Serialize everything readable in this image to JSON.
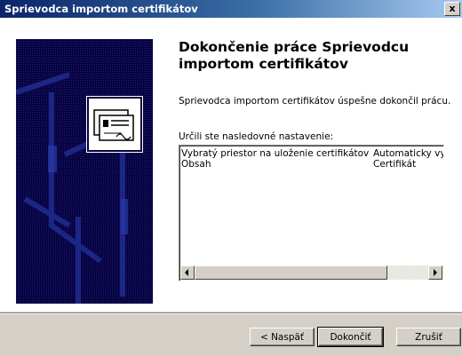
{
  "window": {
    "title": "Sprievodca importom certifikátov",
    "close_glyph": "x"
  },
  "wizard": {
    "heading": "Dokončenie práce Sprievodcu importom certifikátov",
    "success_message": "Sprievodca importom certifikátov úspešne dokončil prácu.",
    "settings_label": "Určili ste nasledovné nastavenie:",
    "settings": [
      {
        "name": "Vybratý priestor na uloženie certifikátov",
        "value": "Automaticky vy"
      },
      {
        "name": "Obsah",
        "value": "Certifikát"
      }
    ],
    "icon": "certificate-icon"
  },
  "buttons": {
    "back": "< Naspäť",
    "finish": "Dokončiť",
    "cancel": "Zrušiť"
  },
  "colors": {
    "title_bar_start": "#0a246a",
    "title_bar_end": "#a6caf0",
    "side_panel": "#05003c",
    "dialog_face": "#d4d0c8"
  }
}
